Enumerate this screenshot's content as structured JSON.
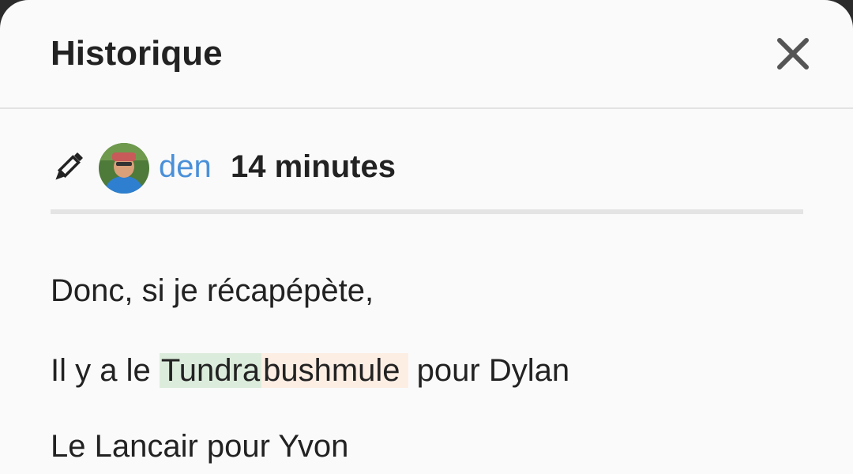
{
  "modal": {
    "title": "Historique",
    "close_icon": "close-icon"
  },
  "revision": {
    "edit_icon": "pencil-icon",
    "username": "den",
    "time": "14 minutes"
  },
  "content": {
    "line1": "Donc, si je récapépète,",
    "line2_prefix": "Il y a le ",
    "line2_inserted": "Tundra",
    "line2_deleted": "bushmule",
    "line2_suffix": " pour Dylan",
    "line3": "Le Lancair pour Yvon"
  },
  "colors": {
    "accent": "#4a90d9",
    "inserted_bg": "#dcecdc",
    "deleted_bg": "#fdeee4",
    "text": "#222222"
  }
}
